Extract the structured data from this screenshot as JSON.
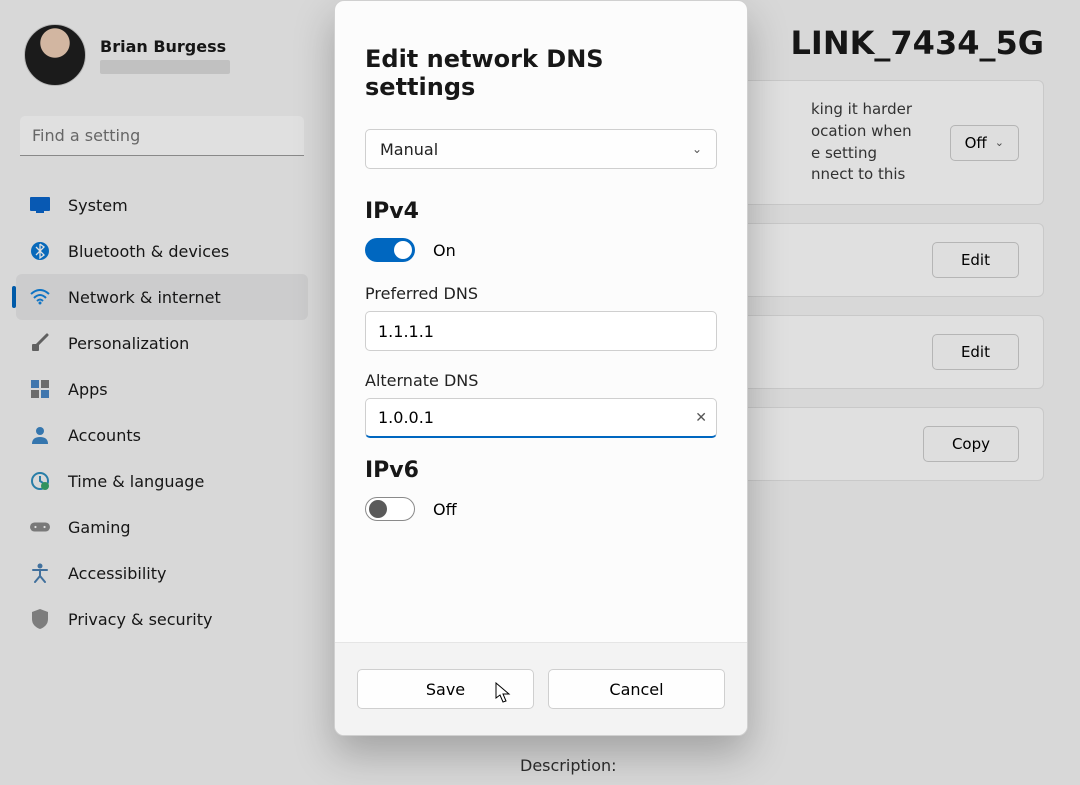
{
  "user": {
    "name": "Brian Burgess"
  },
  "search": {
    "placeholder": "Find a setting"
  },
  "nav": [
    {
      "label": "System"
    },
    {
      "label": "Bluetooth & devices"
    },
    {
      "label": "Network & internet"
    },
    {
      "label": "Personalization"
    },
    {
      "label": "Apps"
    },
    {
      "label": "Accounts"
    },
    {
      "label": "Time & language"
    },
    {
      "label": "Gaming"
    },
    {
      "label": "Accessibility"
    },
    {
      "label": "Privacy & security"
    }
  ],
  "page": {
    "title_fragment": "LINK_7434_5G",
    "card1_text": "king it harder\nocation when\ne setting\nnnect to this",
    "toggle_off": "Off",
    "edit_label": "Edit",
    "copy_label": "Copy",
    "desc_label": "Description:"
  },
  "dialog": {
    "title": "Edit network DNS settings",
    "mode": "Manual",
    "ipv4_heading": "IPv4",
    "ipv4_on_label": "On",
    "preferred_label": "Preferred DNS",
    "preferred_value": "1.1.1.1",
    "alternate_label": "Alternate DNS",
    "alternate_value": "1.0.0.1",
    "ipv6_heading": "IPv6",
    "ipv6_off_label": "Off",
    "save": "Save",
    "cancel": "Cancel"
  }
}
